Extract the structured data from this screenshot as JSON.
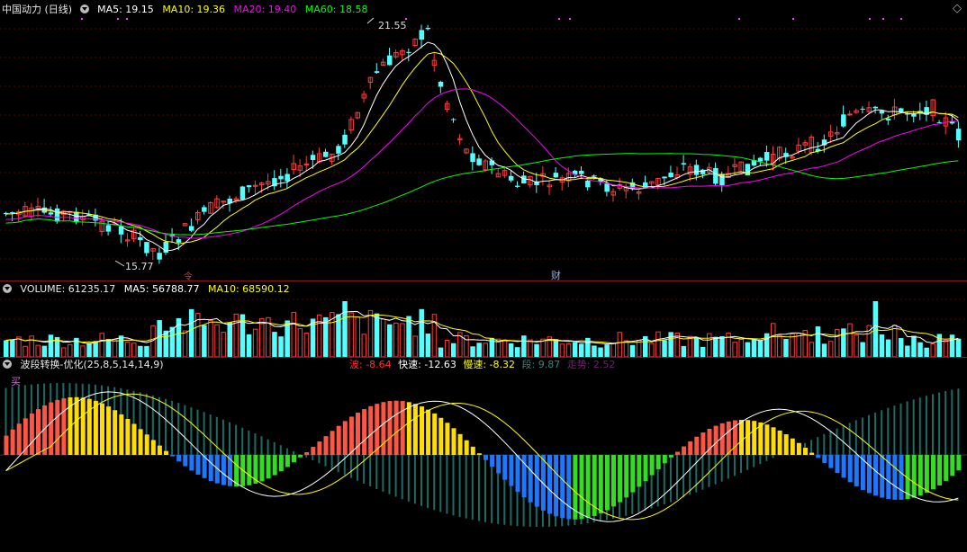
{
  "main": {
    "title": "中国动力 (日线)",
    "ma": [
      {
        "label": "MA5: 19.15",
        "color": "#ffffff"
      },
      {
        "label": "MA10: 19.36",
        "color": "#ffff00"
      },
      {
        "label": "MA20: 19.40",
        "color": "#ff00ff"
      },
      {
        "label": "MA60: 18.58",
        "color": "#00ff00"
      }
    ],
    "high_label": "21.55",
    "low_label": "15.77",
    "marker_left": "令",
    "marker_right": "财",
    "diamond": "◇"
  },
  "volume": {
    "title": "VOLUME: 61235.17",
    "ma5": "MA5: 56788.77",
    "ma10": "MA10: 68590.12"
  },
  "indicator": {
    "title": "波段转换-优化(25,8,5,14,14,9)",
    "values": [
      {
        "label": "波: -8.64",
        "color": "#ff3030"
      },
      {
        "label": "快速: -12.63",
        "color": "#ffffff"
      },
      {
        "label": "慢速: -8.32",
        "color": "#ffff00"
      },
      {
        "label": "段: 9.87",
        "color": "#2e8b80"
      },
      {
        "label": "走势: 2.52",
        "color": "#7a1a7a"
      }
    ],
    "buy_label": "买"
  },
  "colors": {
    "up": "#ff3c3c",
    "down": "#54ffff",
    "grid": "#5a0000",
    "separator": "#8a1515"
  }
}
